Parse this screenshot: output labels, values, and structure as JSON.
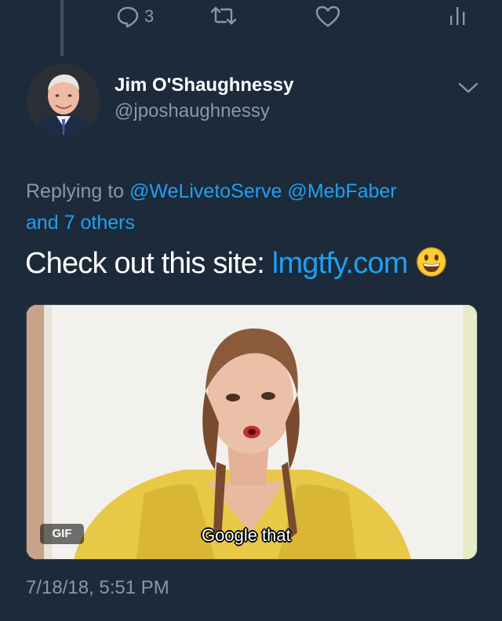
{
  "actions": {
    "reply_count": "3"
  },
  "tweet": {
    "author_name": "Jim O'Shaughnessy",
    "author_handle": "@jposhaughnessy",
    "replying_prefix": "Replying to ",
    "reply_targets": [
      "@WeLivetoServe",
      "@MebFaber"
    ],
    "reply_others": "and 7 others",
    "text_prefix": "Check out this site: ",
    "text_link": "lmgtfy.com",
    "emoji": "smiley-emoji",
    "timestamp": "7/18/18, 5:51 PM"
  },
  "media": {
    "badge": "GIF",
    "caption": "Google that"
  },
  "colors": {
    "background": "#1c2a3a",
    "link": "#1da1f2",
    "secondary_text": "#8899a6"
  }
}
